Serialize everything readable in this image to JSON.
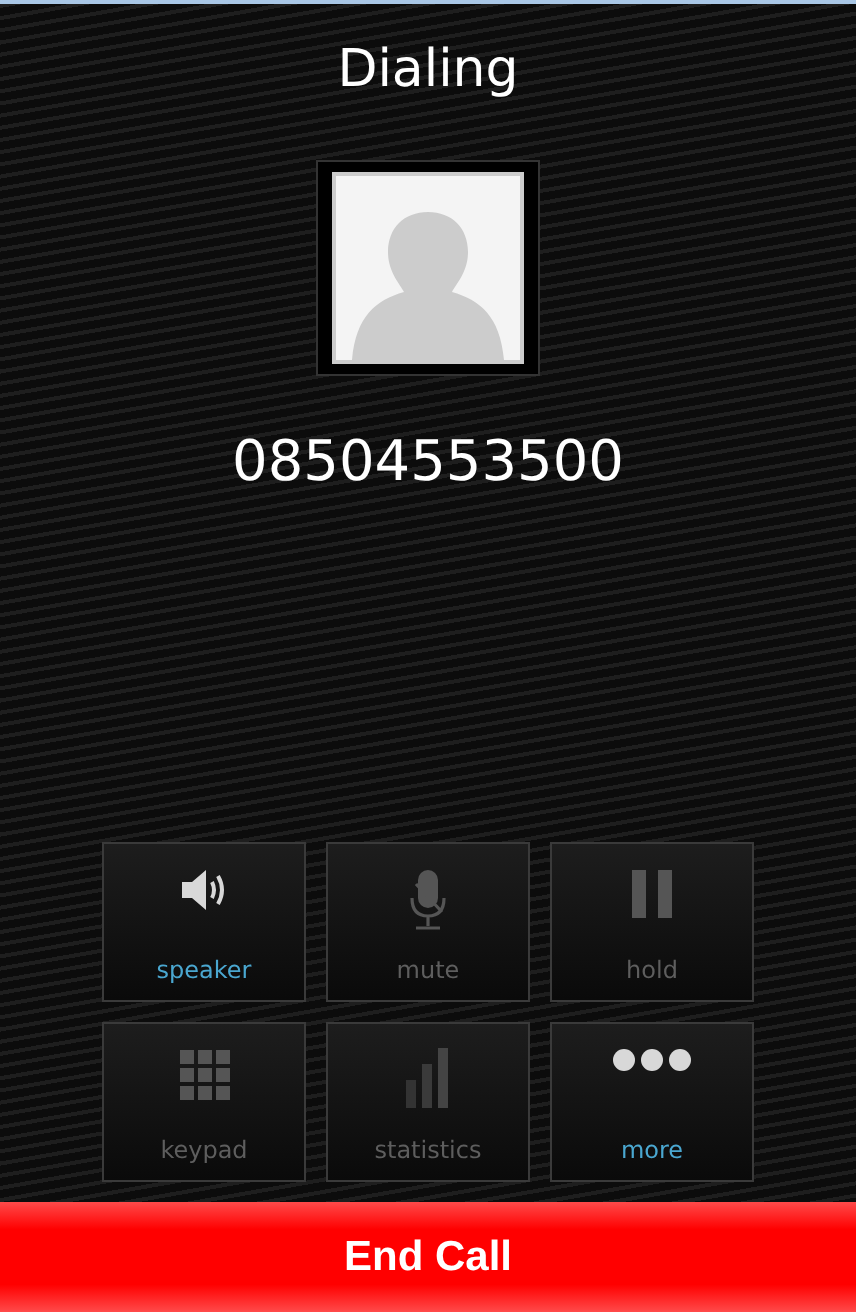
{
  "status": "Dialing",
  "number": "08504553500",
  "controls": [
    {
      "kind": "speaker",
      "label": "speaker",
      "on": true
    },
    {
      "kind": "mute",
      "label": "mute",
      "on": false
    },
    {
      "kind": "hold",
      "label": "hold",
      "on": false
    },
    {
      "kind": "keypad",
      "label": "keypad",
      "on": false
    },
    {
      "kind": "statistics",
      "label": "statistics",
      "on": false
    },
    {
      "kind": "more",
      "label": "more",
      "on": true
    }
  ],
  "end_button": "End Call"
}
